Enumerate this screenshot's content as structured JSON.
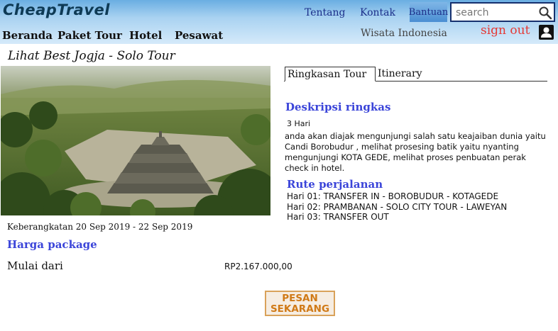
{
  "header": {
    "logo": "CheapTravel",
    "links": [
      "Tentang",
      "Kontak"
    ],
    "bantuan_label": "Bantuan",
    "search": {
      "placeholder": "search",
      "value": ""
    }
  },
  "nav": {
    "items": [
      "Beranda",
      "Paket Tour",
      "Hotel",
      "Pesawat"
    ],
    "wisata": "Wisata Indonesia",
    "signout": "sign out"
  },
  "tour": {
    "title": "Lihat Best Jogja - Solo Tour",
    "departure": "Keberangkatan 20 Sep 2019 - 22 Sep 2019",
    "harga_heading": "Harga package",
    "mulai_label": "Mulai dari",
    "price": "RP2.167.000,00",
    "order_button": "PESAN SEKARANG"
  },
  "tabs": [
    "Ringkasan Tour",
    "Itinerary"
  ],
  "summary": {
    "heading": "Deskripsi ringkas",
    "duration": "3 Hari",
    "description": "anda akan diajak mengunjungi salah satu keajaiban dunia yaitu Candi Borobudur , melihat prosesing batik yaitu nyanting mengunjungi KOTA GEDE, melihat proses penbuatan perak check in hotel.",
    "route_heading": "Rute perjalanan",
    "route": [
      "Hari 01: TRANSFER IN - BOROBUDUR - KOTAGEDE",
      "Hari 02: PRAMBANAN - SOLO CITY TOUR - LAWEYAN",
      "Hari 03: TRANSFER OUT"
    ]
  },
  "colors": {
    "accent_heading": "#3b45d9",
    "signout": "#e53935",
    "order_text": "#d07a17",
    "order_border": "#d9a25a",
    "header_top": "#6aaee2"
  },
  "icons": {
    "search": "search-icon",
    "user": "user-icon"
  }
}
